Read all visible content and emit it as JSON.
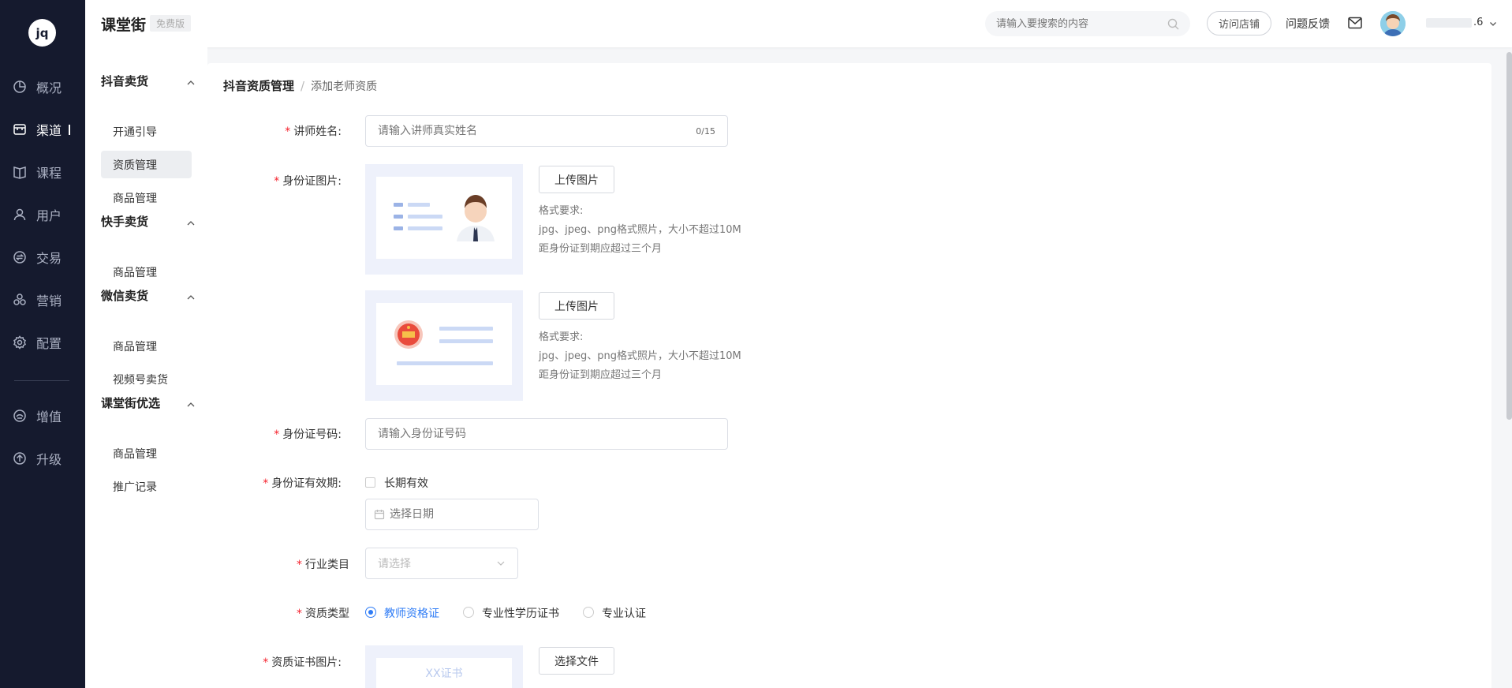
{
  "nav": {
    "logo": "jq",
    "items": [
      {
        "label": "概况",
        "icon": "pie-chart-icon"
      },
      {
        "label": "渠道",
        "icon": "store-icon"
      },
      {
        "label": "课程",
        "icon": "book-icon"
      },
      {
        "label": "用户",
        "icon": "user-icon"
      },
      {
        "label": "交易",
        "icon": "exchange-icon"
      },
      {
        "label": "营销",
        "icon": "marketing-icon"
      },
      {
        "label": "配置",
        "icon": "gear-icon"
      },
      {
        "label": "增值",
        "icon": "value-added-icon"
      },
      {
        "label": "升级",
        "icon": "upgrade-icon"
      }
    ],
    "active_index": 1
  },
  "header": {
    "brand": "课堂街",
    "plan_tag": "免费版",
    "search_placeholder": "请输入要搜索的内容",
    "visit_store": "访问店铺",
    "feedback": "问题反馈",
    "user_suffix": ".6"
  },
  "subnav": {
    "groups": [
      {
        "title": "抖音卖货",
        "items": [
          "开通引导",
          "资质管理",
          "商品管理"
        ]
      },
      {
        "title": "快手卖货",
        "items": [
          "商品管理"
        ]
      },
      {
        "title": "微信卖货",
        "items": [
          "商品管理",
          "视频号卖货"
        ]
      },
      {
        "title": "课堂街优选",
        "items": [
          "商品管理",
          "推广记录"
        ]
      }
    ],
    "active_item": "资质管理"
  },
  "breadcrumb": {
    "parent": "抖音资质管理",
    "separator": "/",
    "current": "添加老师资质"
  },
  "form": {
    "lecturer_name": {
      "label": "讲师姓名:",
      "placeholder": "请输入讲师真实姓名",
      "counter": "0/15"
    },
    "id_images": {
      "label": "身份证图片:",
      "upload_label": "上传图片",
      "hint_title": "格式要求:",
      "hint_line1": "jpg、jpeg、png格式照片，大小不超过10M",
      "hint_line2": "距身份证到期应超过三个月"
    },
    "id_number": {
      "label": "身份证号码:",
      "placeholder": "请输入身份证号码"
    },
    "id_validity": {
      "label": "身份证有效期:",
      "long_term": "长期有效",
      "date_placeholder": "选择日期"
    },
    "industry": {
      "label": "行业类目",
      "placeholder": "请选择"
    },
    "qualification_type": {
      "label": "资质类型",
      "options": [
        "教师资格证",
        "专业性学历证书",
        "专业认证"
      ],
      "selected_index": 0
    },
    "certificate_image": {
      "label": "资质证书图片:",
      "placeholder_text": "XX证书",
      "button": "选择文件"
    }
  },
  "colors": {
    "nav_bg": "#151a2e",
    "accent": "#2f7cf6",
    "required": "#f5222d"
  }
}
